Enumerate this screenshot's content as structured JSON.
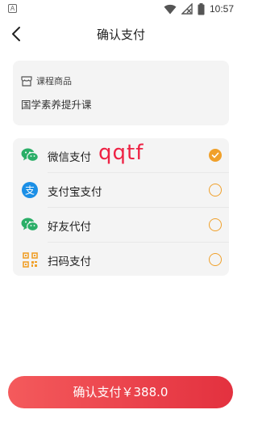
{
  "status_bar": {
    "badge": "A",
    "time": "10:57",
    "icons": [
      "wifi-icon",
      "signal-off-icon",
      "battery-icon"
    ]
  },
  "nav": {
    "back_icon": "chevron-left-icon",
    "title": "确认支付"
  },
  "product": {
    "category_icon": "store-icon",
    "category_label": "课程商品",
    "name": "国学素养提升课"
  },
  "payment_methods": [
    {
      "label": "微信支付",
      "icon": "wechat-icon",
      "selected": true
    },
    {
      "label": "支付宝支付",
      "icon": "alipay-icon",
      "selected": false
    },
    {
      "label": "好友代付",
      "icon": "wechat-icon",
      "selected": false
    },
    {
      "label": "扫码支付",
      "icon": "qr-code-icon",
      "selected": false
    }
  ],
  "watermark": "qqtf",
  "confirm_button": {
    "label": "确认支付￥388.0"
  },
  "colors": {
    "accent": "#f0a02a",
    "wechat": "#2aae67",
    "alipay": "#1b8fe6",
    "button_start": "#f45a5c",
    "button_end": "#e3313f"
  }
}
